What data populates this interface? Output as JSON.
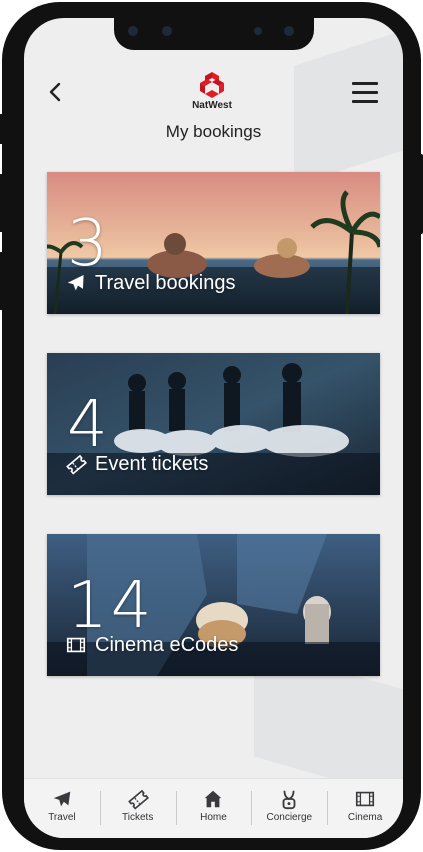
{
  "header": {
    "brand": "NatWest",
    "title": "My bookings"
  },
  "cards": [
    {
      "count": "3",
      "label": "Travel bookings",
      "icon": "airplane-icon"
    },
    {
      "count": "4",
      "label": "Event tickets",
      "icon": "ticket-icon"
    },
    {
      "count": "14",
      "label": "Cinema eCodes",
      "icon": "film-icon"
    }
  ],
  "tabbar": [
    {
      "label": "Travel",
      "icon": "airplane-icon"
    },
    {
      "label": "Tickets",
      "icon": "ticket-icon"
    },
    {
      "label": "Home",
      "icon": "home-icon"
    },
    {
      "label": "Concierge",
      "icon": "concierge-icon"
    },
    {
      "label": "Cinema",
      "icon": "film-icon"
    }
  ],
  "colors": {
    "brand_red": "#e31b23",
    "brand_purple": "#5a287d",
    "screen_bg": "#eeeeef",
    "text": "#222222"
  }
}
